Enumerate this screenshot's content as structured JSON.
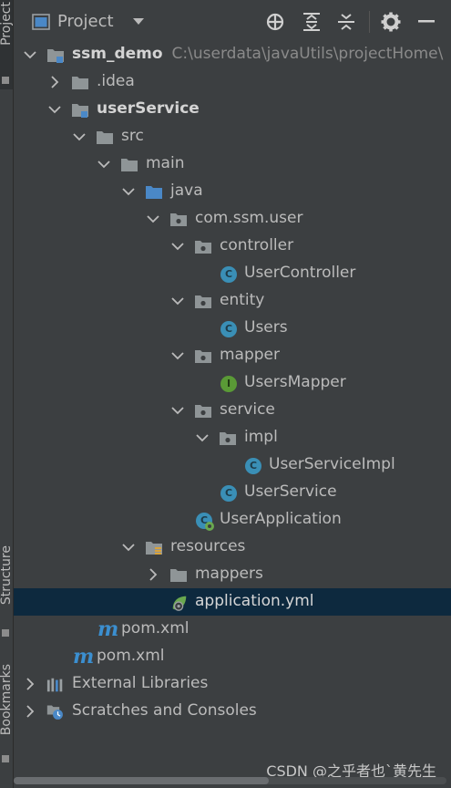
{
  "side_tabs": {
    "project": "Project",
    "structure": "Structure",
    "bookmarks": "Bookmarks"
  },
  "header": {
    "title": "Project",
    "icons": [
      "window-icon",
      "dropdown-icon",
      "locate-icon",
      "expand-all-icon",
      "collapse-all-icon",
      "gear-icon",
      "minimize-icon"
    ]
  },
  "tree": {
    "root": {
      "name": "ssm_demo",
      "path": "C:\\userdata\\javaUtils\\projectHome\\"
    },
    "idea": ".idea",
    "module": "userService",
    "src": "src",
    "main": "main",
    "java": "java",
    "pkg": "com.ssm.user",
    "controller": "controller",
    "user_controller": "UserController",
    "entity": "entity",
    "users": "Users",
    "mapper": "mapper",
    "users_mapper": "UsersMapper",
    "service": "service",
    "impl": "impl",
    "user_service_impl": "UserServiceImpl",
    "user_service": "UserService",
    "user_application": "UserApplication",
    "resources": "resources",
    "mappers": "mappers",
    "application_yml": "application.yml",
    "module_pom": "pom.xml",
    "root_pom": "pom.xml",
    "external_libraries": "External Libraries",
    "scratches": "Scratches and Consoles",
    "class_badge": "C",
    "interface_badge": "I"
  },
  "colors": {
    "background": "#3c3f41",
    "selection": "#0d293e",
    "text": "#bbbbbb",
    "folder": "#8f9597",
    "source_folder": "#4a88c7",
    "class_icon": "#3a8fb6",
    "interface_icon": "#5a9a36",
    "maven": "#3b8fd0"
  },
  "watermark": "CSDN @之乎者也`黄先生"
}
